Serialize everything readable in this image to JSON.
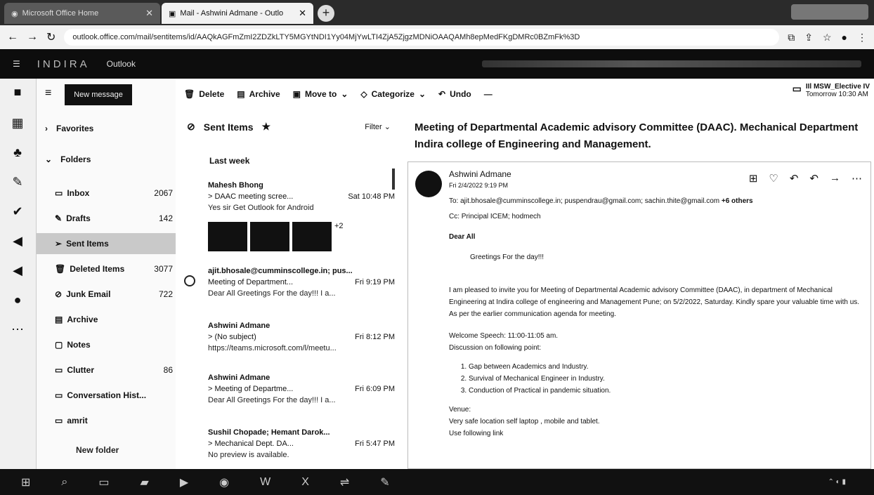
{
  "browser": {
    "tabs": [
      {
        "label": "Microsoft Office Home"
      },
      {
        "label": "Mail - Ashwini Admane - Outlo"
      }
    ],
    "url": "outlook.office.com/mail/sentitems/id/AAQkAGFmZmI2ZDZkLTY5MGYtNDI1Yy04MjYwLTI4ZjA5ZjgzMDNiOAAQAMh8epMedFKgDMRc0BZmFk%3D"
  },
  "outlook": {
    "app_label": "Outlook",
    "brand": "INDIRA"
  },
  "folders": {
    "new_message": "New message",
    "favorites": "Favorites",
    "folders_label": "Folders",
    "items": [
      {
        "label": "Inbox",
        "count": "2067",
        "icon": "inbox-icon"
      },
      {
        "label": "Drafts",
        "count": "142",
        "icon": "pencil-icon"
      },
      {
        "label": "Sent Items",
        "count": "",
        "icon": "send-icon",
        "selected": true
      },
      {
        "label": "Deleted Items",
        "count": "3077",
        "icon": "trash-icon"
      },
      {
        "label": "Junk Email",
        "count": "722",
        "icon": "block-icon"
      },
      {
        "label": "Archive",
        "count": "",
        "icon": "archive-icon"
      },
      {
        "label": "Notes",
        "count": "",
        "icon": "note-icon"
      },
      {
        "label": "Clutter",
        "count": "86",
        "icon": "folder-icon"
      },
      {
        "label": "Conversation Hist...",
        "count": "",
        "icon": "folder-icon"
      },
      {
        "label": "amrit",
        "count": "",
        "icon": "folder-icon"
      }
    ],
    "new_folder": "New folder"
  },
  "toolbar": {
    "delete": "Delete",
    "archive": "Archive",
    "move_to": "Move to",
    "categorize": "Categorize",
    "undo": "Undo",
    "calendar_event": "IIl MSW_Elective IV",
    "calendar_time": "Tomorrow 10:30 AM"
  },
  "message_list": {
    "title": "Sent Items",
    "filter": "Filter",
    "group": "Last week",
    "messages": [
      {
        "from": "Mahesh Bhong",
        "subject": "> DAAC meeting scree...",
        "time": "Sat 10:48 PM",
        "preview": "Yes sir Get Outlook for Android",
        "more": "+2"
      },
      {
        "from": "ajit.bhosale@cumminscollege.in; pus...",
        "subject": "Meeting of Department...",
        "time": "Fri 9:19 PM",
        "preview": "Dear All Greetings For the day!!! I a..."
      },
      {
        "from": "Ashwini Admane",
        "subject": "> (No subject)",
        "time": "Fri 8:12 PM",
        "preview": "https://teams.microsoft.com/l/meetu..."
      },
      {
        "from": "Ashwini Admane",
        "subject": "> Meeting of Departme...",
        "time": "Fri 6:09 PM",
        "preview": "Dear All Greetings For the day!!! I a..."
      },
      {
        "from": "Sushil Chopade; Hemant Darok...",
        "subject": "> Mechanical Dept. DA...",
        "time": "Fri 5:47 PM",
        "preview": "No preview is available."
      }
    ]
  },
  "reading": {
    "subject": "Meeting of Departmental Academic advisory Committee (DAAC). Mechanical Department Indira college of Engineering and Management.",
    "sender": "Ashwini Admane",
    "date": "Fri 2/4/2022 9:19 PM",
    "to_label": "To:",
    "to": "ajit.bhosale@cumminscollege.in; puspendrau@gmail.com; sachin.thite@gmail.com",
    "to_more": "+6 others",
    "cc": "Cc: Principal ICEM; hodmech",
    "body": {
      "salutation": "Dear All",
      "greeting": "Greetings For the day!!!",
      "para1": "I am pleased to invite you for Meeting of Departmental Academic advisory Committee (DAAC), in department of Mechanical Engineering at Indira college of engineering and Management Pune; on 5/2/2022, Saturday. Kindly spare your valuable time with us.",
      "para2": "As per the earlier communication agenda for meeting.",
      "welcome": "Welcome Speech: 11:00-11:05 am.",
      "discussion": "Discussion on following point:",
      "points": [
        "Gap between Academics and Industry.",
        "Survival of Mechanical Engineer in Industry.",
        "Conduction of Practical in pandemic situation."
      ],
      "venue_label": "Venue:",
      "venue": "Very safe location self laptop , mobile and tablet.",
      "link": "Use following link"
    }
  }
}
